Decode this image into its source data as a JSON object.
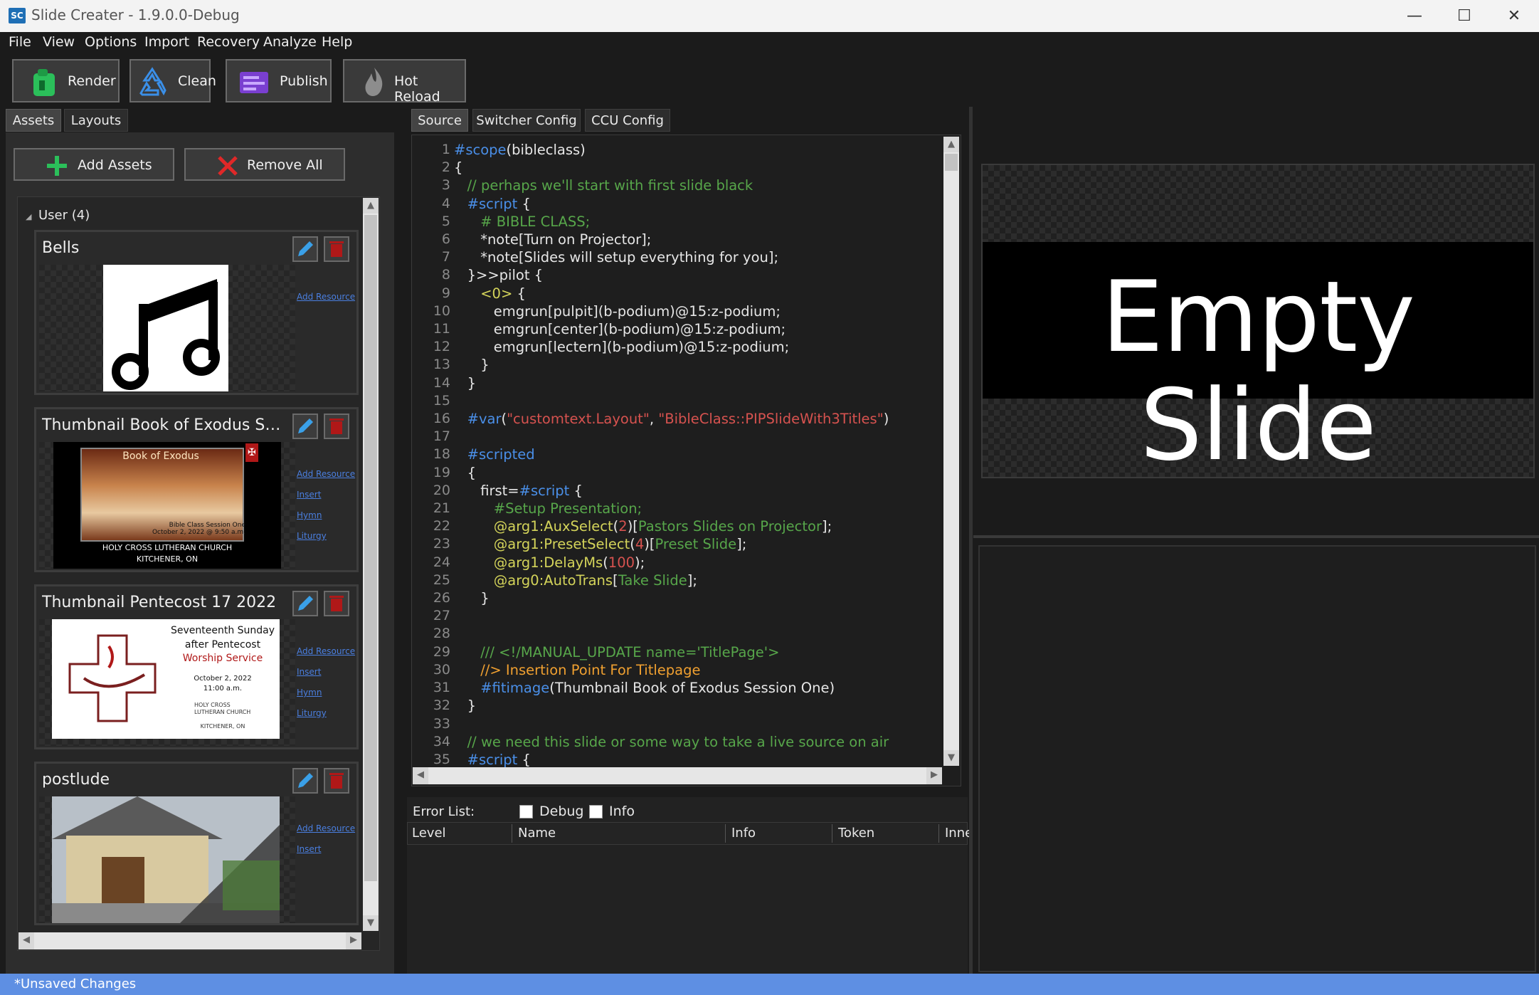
{
  "window": {
    "title": "Slide Creater - 1.9.0.0-Debug",
    "icon_text": "SC",
    "min": "—",
    "max": "☐",
    "close": "✕"
  },
  "menu": [
    "File",
    "View",
    "Options",
    "Import",
    "Recovery",
    "Analyze",
    "Help"
  ],
  "toolbar": {
    "render": "Render",
    "clean": "Clean",
    "publish": "Publish",
    "hot_reload": "Hot Reload"
  },
  "left_tabs": [
    "Assets",
    "Layouts"
  ],
  "assets": {
    "add": "Add Assets",
    "remove": "Remove All",
    "group": "User (4)",
    "cards": [
      {
        "title": "Bells",
        "links": [
          "Add Resource"
        ]
      },
      {
        "title": "Thumbnail Book of Exodus Sessio...",
        "links": [
          "Add Resource",
          "Insert",
          "Hymn",
          "Liturgy"
        ],
        "thumb": {
          "heading": "Book of Exodus",
          "line1": "Bible Class Session One",
          "line2": "October 2, 2022 @ 9:50 a.m.",
          "church": "HOLY CROSS LUTHERAN CHURCH",
          "city": "KITCHENER, ON"
        }
      },
      {
        "title": "Thumbnail Pentecost 17 2022",
        "links": [
          "Add Resource",
          "Insert",
          "Hymn",
          "Liturgy"
        ],
        "thumb": {
          "l1": "Seventeenth Sunday",
          "l2": "after Pentecost",
          "l3": "Worship Service",
          "l4": "October 2, 2022",
          "l5": "11:00 a.m.",
          "church1": "HOLY CROSS",
          "church2": "LUTHERAN CHURCH",
          "city": "KITCHENER, ON"
        }
      },
      {
        "title": "postlude",
        "links": [
          "Add Resource",
          "Insert"
        ]
      }
    ]
  },
  "center_tabs": [
    "Source",
    "Switcher Config",
    "CCU Config"
  ],
  "error_list": {
    "label": "Error List:",
    "debug": "Debug",
    "info": "Info",
    "columns": [
      "Level",
      "Name",
      "Info",
      "Token",
      "Inne"
    ]
  },
  "preview": {
    "text": "Empty Slide"
  },
  "status": "*Unsaved Changes",
  "colors": {
    "accent": "#5e8fe3",
    "keyword": "#4a8fe8",
    "comment": "#57a64a",
    "string": "#d6524f"
  }
}
